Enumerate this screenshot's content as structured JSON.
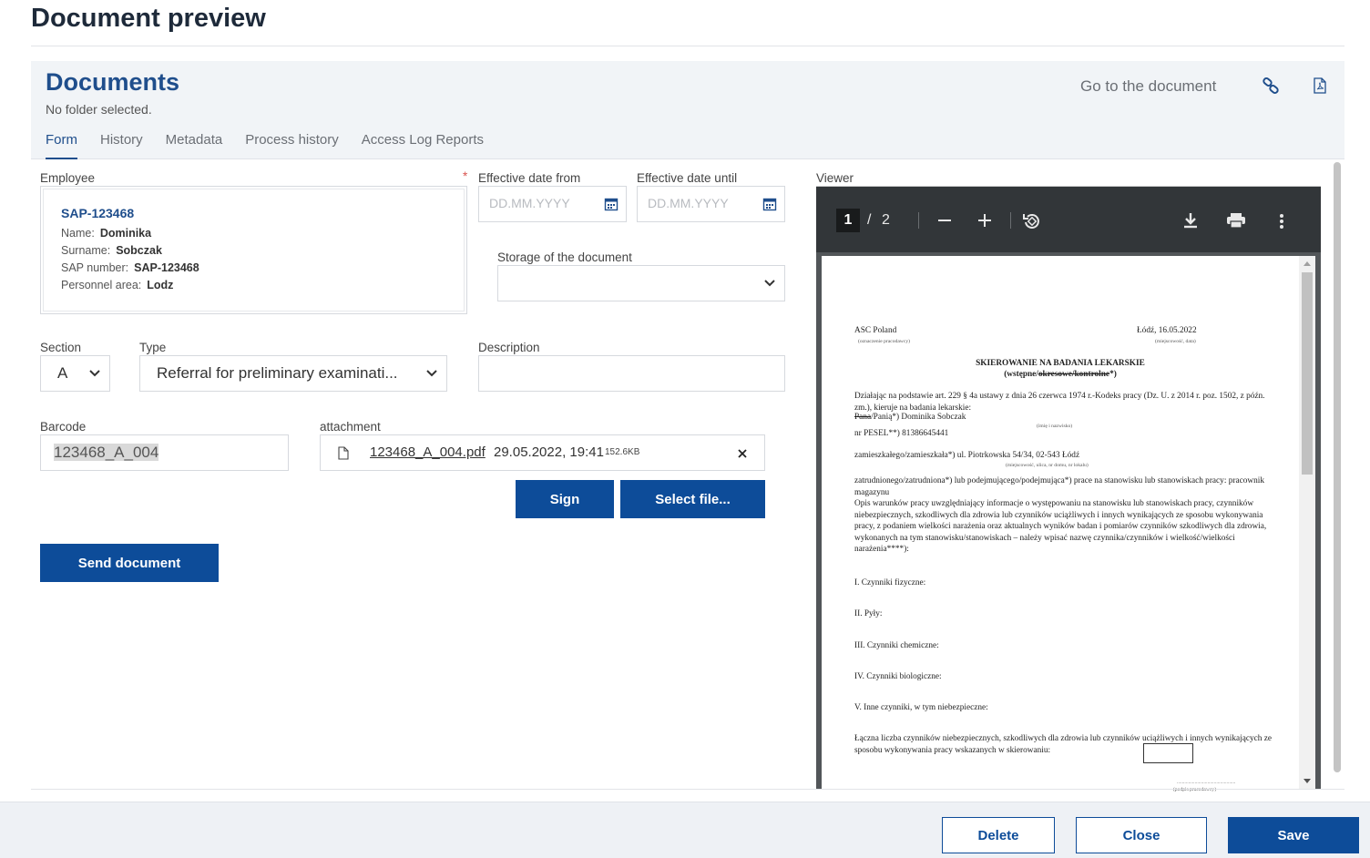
{
  "page_title": "Document preview",
  "header": {
    "title": "Documents",
    "subtitle": "No folder selected.",
    "goto_label": "Go to the document"
  },
  "tabs": [
    {
      "label": "Form"
    },
    {
      "label": "History"
    },
    {
      "label": "Metadata"
    },
    {
      "label": "Process history"
    },
    {
      "label": "Access Log Reports"
    }
  ],
  "form": {
    "employee_label": "Employee",
    "employee": {
      "id": "SAP-123468",
      "name_label": "Name:",
      "name": "Dominika",
      "surname_label": "Surname:",
      "surname": "Sobczak",
      "sap_label": "SAP number:",
      "sap": "SAP-123468",
      "area_label": "Personnel area:",
      "area": "Lodz"
    },
    "required_mark": "*",
    "eff_from_label": "Effective date from",
    "eff_from_placeholder": "DD.MM.YYYY",
    "eff_until_label": "Effective date until",
    "eff_until_placeholder": "DD.MM.YYYY",
    "storage_label": "Storage of the document",
    "storage_value": "",
    "section_label": "Section",
    "section_value": "A",
    "type_label": "Type",
    "type_value": "Referral for preliminary examinati...",
    "description_label": "Description",
    "description_value": "",
    "barcode_label": "Barcode",
    "barcode_value": "123468_A_004",
    "attachment_label": "attachment",
    "attachment": {
      "filename": "123468_A_004.pdf",
      "datetime": "29.05.2022, 19:41",
      "size": "152.6KB"
    },
    "sign_label": "Sign",
    "select_file_label": "Select file...",
    "send_label": "Send document"
  },
  "viewer": {
    "label": "Viewer",
    "current_page": "1",
    "separator": "/",
    "total_pages": "2",
    "doc": {
      "employer": "ASC Poland",
      "employer_note": "(oznaczenie pracodawcy)",
      "place_date": "Łódź, 16.05.2022",
      "place_date_note": "(miejscowość, data)",
      "heading": "SKIEROWANIE NA BADANIA LEKARSKIE",
      "subheading_pre": "(wstępne/",
      "subheading_struck": "okresowe/kontrolne",
      "subheading_post": "*)",
      "para1": "Działając na podstawie art. 229 § 4a ustawy z dnia 26 czerwca 1974 r.-Kodeks pracy (Dz. U. z 2014 r. poz. 1502, z późn. zm.), kieruje na badania lekarskie:",
      "person_struck": "Pana",
      "person_rest": "/Panią*) Dominika Sobczak",
      "person_note": "(imię i nazwisko)",
      "pesel": "nr PESEL**) 81386645441",
      "address": "zamieszkałego/zamieszkała*) ul. Piotrkowska 54/34, 02-543 Łódź",
      "address_note": "(miejscowość, ulica, nr domu, nr lokalu)",
      "para2": "zatrudnionego/zatrudniona*) lub podejmującego/podejmująca*) prace na stanowisku lub stanowiskach pracy: pracownik magazynu",
      "para3": "Opis warunków pracy uwzględniający informacje o występowaniu na stanowisku lub stanowiskach pracy, czynników niebezpiecznych, szkodliwych dla zdrowia lub czynników uciążliwych i innych wynikających ze sposobu wykonywania pracy, z podaniem wielkości narażenia oraz aktualnych wyników badan i pomiarów czynników szkodliwych dla zdrowia, wykonanych na tym stanowisku/stanowiskach – należy wpisać nazwę czynnika/czynników i wielkość/wielkości narażenia****):",
      "item1": "I. Czynniki fizyczne:",
      "item2": "II. Pyły:",
      "item3": "III. Czynniki chemiczne:",
      "item4": "IV. Czynniki biologiczne:",
      "item5": "V. Inne czynniki, w tym niebezpieczne:",
      "para4": "Łączna liczba czynników niebezpiecznych, szkodliwych dla zdrowia lub czynników uciążliwych i innych wynikających ze sposobu wykonywania pracy wskazanych w skierowaniu:",
      "sign_dots": "..............................................",
      "sign_note": "(podpis pracodawcy)"
    }
  },
  "footer": {
    "delete_label": "Delete",
    "close_label": "Close",
    "save_label": "Save"
  },
  "colors": {
    "brand": "#0d4c99",
    "title_blue": "#1f4e8c",
    "required": "#d9534f"
  }
}
